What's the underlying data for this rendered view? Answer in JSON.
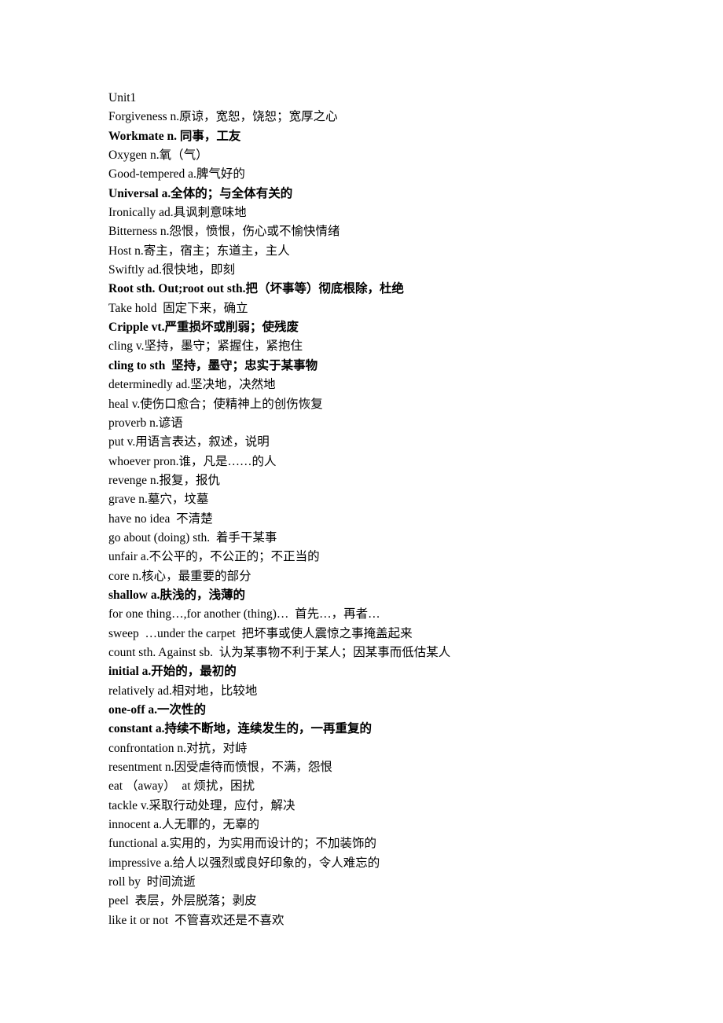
{
  "document": {
    "title": "Unit1",
    "page_background": "#ffffff",
    "text_color": "#000000",
    "lines": [
      {
        "text": "Unit1",
        "bold": false
      },
      {
        "text": "Forgiveness n.原谅，宽恕，饶恕；宽厚之心",
        "bold": false
      },
      {
        "text": "Workmate n. 同事，工友",
        "bold": true
      },
      {
        "text": "Oxygen n.氧（气）",
        "bold": false
      },
      {
        "text": "Good-tempered a.脾气好的",
        "bold": false
      },
      {
        "text": "Universal a.全体的；与全体有关的",
        "bold": true
      },
      {
        "text": "Ironically ad.具讽刺意味地",
        "bold": false
      },
      {
        "text": "Bitterness n.怨恨，愤恨，伤心或不愉快情绪",
        "bold": false
      },
      {
        "text": "Host n.寄主，宿主；东道主，主人",
        "bold": false
      },
      {
        "text": "Swiftly ad.很快地，即刻",
        "bold": false
      },
      {
        "text": "Root sth. Out;root out sth.把（坏事等）彻底根除，杜绝",
        "bold": true
      },
      {
        "text": "Take hold  固定下来，确立",
        "bold": false
      },
      {
        "text": "Cripple vt.严重损坏或削弱；使残废",
        "bold": true
      },
      {
        "text": "cling v.坚持，墨守；紧握住，紧抱住",
        "bold": false
      },
      {
        "text": "cling to sth  坚持，墨守；忠实于某事物",
        "bold": true
      },
      {
        "text": "determinedly ad.坚决地，决然地",
        "bold": false
      },
      {
        "text": "heal v.使伤口愈合；使精神上的创伤恢复",
        "bold": false
      },
      {
        "text": "proverb n.谚语",
        "bold": false
      },
      {
        "text": "put v.用语言表达，叙述，说明",
        "bold": false
      },
      {
        "text": "whoever pron.谁，凡是……的人",
        "bold": false
      },
      {
        "text": "revenge n.报复，报仇",
        "bold": false
      },
      {
        "text": "grave n.墓穴，坟墓",
        "bold": false
      },
      {
        "text": "have no idea  不清楚",
        "bold": false
      },
      {
        "text": "go about (doing) sth.  着手干某事",
        "bold": false
      },
      {
        "text": "unfair a.不公平的，不公正的；不正当的",
        "bold": false
      },
      {
        "text": "core n.核心，最重要的部分",
        "bold": false
      },
      {
        "text": "shallow a.肤浅的，浅薄的",
        "bold": true
      },
      {
        "text": "for one thing…,for another (thing)…  首先…，再者…",
        "bold": false
      },
      {
        "text": "sweep  …under the carpet  把坏事或使人震惊之事掩盖起来",
        "bold": false
      },
      {
        "text": "count sth. Against sb.  认为某事物不利于某人；因某事而低估某人",
        "bold": false
      },
      {
        "text": "initial a.开始的，最初的",
        "bold": true
      },
      {
        "text": "relatively ad.相对地，比较地",
        "bold": false
      },
      {
        "text": "one-off a.一次性的",
        "bold": true
      },
      {
        "text": "constant a.持续不断地，连续发生的，一再重复的",
        "bold": true
      },
      {
        "text": "confrontation n.对抗，对峙",
        "bold": false
      },
      {
        "text": "resentment n.因受虐待而愤恨，不满，怨恨",
        "bold": false
      },
      {
        "text": "eat （away）  at 烦扰，困扰",
        "bold": false
      },
      {
        "text": "tackle v.采取行动处理，应付，解决",
        "bold": false
      },
      {
        "text": "innocent a.人无罪的，无辜的",
        "bold": false
      },
      {
        "text": "functional a.实用的，为实用而设计的；不加装饰的",
        "bold": false
      },
      {
        "text": "impressive a.给人以强烈或良好印象的，令人难忘的",
        "bold": false
      },
      {
        "text": "roll by  时间流逝",
        "bold": false
      },
      {
        "text": "peel  表层，外层脱落；剥皮",
        "bold": false
      },
      {
        "text": "like it or not  不管喜欢还是不喜欢",
        "bold": false
      }
    ]
  }
}
